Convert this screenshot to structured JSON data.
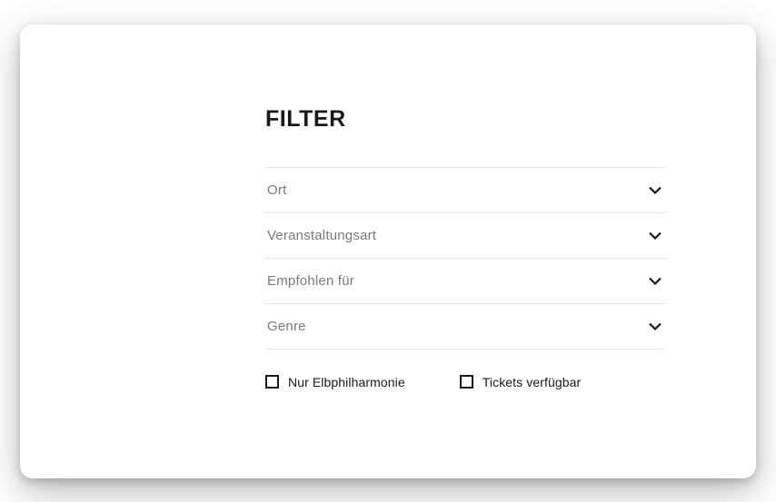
{
  "filter": {
    "heading": "FILTER",
    "dropdowns": [
      {
        "label": "Ort"
      },
      {
        "label": "Veranstaltungsart"
      },
      {
        "label": "Empfohlen für"
      },
      {
        "label": "Genre"
      }
    ],
    "checkboxes": [
      {
        "label": "Nur Elbphilharmonie"
      },
      {
        "label": "Tickets verfügbar"
      }
    ]
  }
}
